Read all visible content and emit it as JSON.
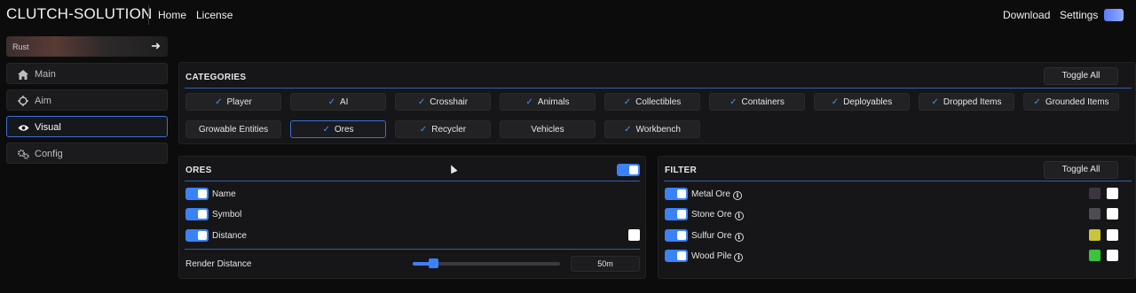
{
  "topbar": {
    "brand": "CLUTCH-SOLUTION",
    "nav_left": [
      "Home",
      "License"
    ],
    "nav_right": [
      "Download",
      "Settings"
    ]
  },
  "sidebar": {
    "game": "Rust",
    "items": [
      {
        "label": "Main",
        "icon": "home-icon",
        "active": false
      },
      {
        "label": "Aim",
        "icon": "crosshair-icon",
        "active": false
      },
      {
        "label": "Visual",
        "icon": "eye-icon",
        "active": true
      },
      {
        "label": "Config",
        "icon": "gears-icon",
        "active": false
      }
    ]
  },
  "categories": {
    "title": "CATEGORIES",
    "toggle_all": "Toggle All",
    "items": [
      {
        "label": "Player",
        "checked": true
      },
      {
        "label": "AI",
        "checked": true
      },
      {
        "label": "Crosshair",
        "checked": true
      },
      {
        "label": "Animals",
        "checked": true
      },
      {
        "label": "Collectibles",
        "checked": true
      },
      {
        "label": "Containers",
        "checked": true
      },
      {
        "label": "Deployables",
        "checked": true
      },
      {
        "label": "Dropped Items",
        "checked": true
      },
      {
        "label": "Grounded Items",
        "checked": true
      },
      {
        "label": "Growable Entities",
        "checked": false
      },
      {
        "label": "Ores",
        "checked": true,
        "selected": true
      },
      {
        "label": "Recycler",
        "checked": true
      },
      {
        "label": "Vehicles",
        "checked": false
      },
      {
        "label": "Workbench",
        "checked": true
      }
    ]
  },
  "ores": {
    "title": "ORES",
    "enabled": true,
    "options": [
      {
        "label": "Name",
        "on": true
      },
      {
        "label": "Symbol",
        "on": true
      },
      {
        "label": "Distance",
        "on": true
      }
    ],
    "render_distance": {
      "label": "Render Distance",
      "value": "50m",
      "fraction": 0.14
    }
  },
  "filter": {
    "title": "FILTER",
    "toggle_all": "Toggle All",
    "items": [
      {
        "label": "Metal Ore",
        "on": true,
        "color": "#3b3640"
      },
      {
        "label": "Stone Ore",
        "on": true,
        "color": "#4c4c52"
      },
      {
        "label": "Sulfur Ore",
        "on": true,
        "color": "#c9c43a"
      },
      {
        "label": "Wood Pile",
        "on": true,
        "color": "#3cc23c"
      }
    ]
  },
  "colors": {
    "accent": "#3b82f6",
    "accent_line": "#2f5fb8",
    "background": "#0c0c0d",
    "panel": "#161618"
  }
}
